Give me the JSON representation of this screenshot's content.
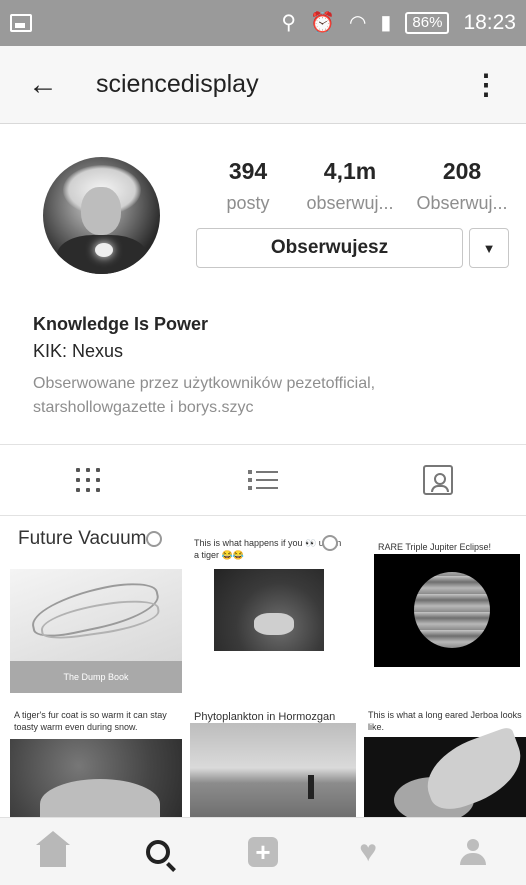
{
  "status_bar": {
    "battery": "86%",
    "time": "18:23"
  },
  "header": {
    "username": "sciencedisplay"
  },
  "profile": {
    "stats": [
      {
        "value": "394",
        "label": "posty"
      },
      {
        "value": "4,1m",
        "label": "obserwuj..."
      },
      {
        "value": "208",
        "label": "Obserwuj..."
      }
    ],
    "follow_button": "Obserwujesz",
    "name": "Knowledge Is Power",
    "bio_line": "KIK: Nexus",
    "followed_by": "Obserwowane przez użytkowników pezetofficial, starshollowgazette i borys.szyc"
  },
  "posts": [
    {
      "caption": "Future Vacuum",
      "tagline": "The Dump Book"
    },
    {
      "caption": "This is what happens if you 👀 up on a tiger 😂😂"
    },
    {
      "caption": "RARE Triple Jupiter Eclipse!"
    },
    {
      "caption": "A tiger's fur coat is so warm it can stay toasty warm even during snow."
    },
    {
      "caption": "Phytoplankton in Hormozgan"
    },
    {
      "caption": "This is what a long eared Jerboa looks like."
    }
  ]
}
